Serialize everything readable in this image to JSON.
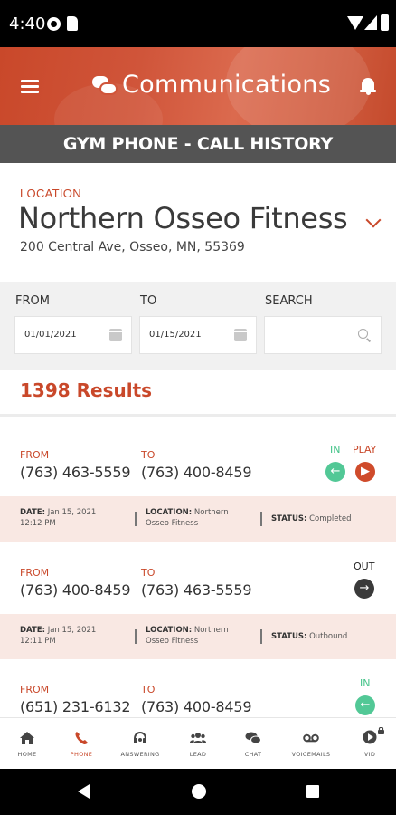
{
  "status_bar": {
    "time": "4:40"
  },
  "header": {
    "title": "Communications"
  },
  "subheader": {
    "title": "GYM PHONE - CALL HISTORY"
  },
  "location": {
    "label": "LOCATION",
    "name": "Northern Osseo Fitness",
    "address": "200 Central Ave, Osseo, MN, 55369"
  },
  "filters": {
    "from_label": "FROM",
    "to_label": "TO",
    "search_label": "SEARCH",
    "from_value": "01/01/2021",
    "to_value": "01/15/2021",
    "search_value": ""
  },
  "results": {
    "count_text": "1398 Results"
  },
  "calls": [
    {
      "from_label": "FROM",
      "to_label": "TO",
      "from": "(763) 463-5559",
      "to": "(763) 400-8459",
      "direction": "IN",
      "play_label": "PLAY",
      "date_label": "DATE:",
      "date": "Jan 15, 2021",
      "time": "12:12 PM",
      "location_label": "LOCATION:",
      "location_line1": "Northern",
      "location_line2": "Osseo Fitness",
      "status_label": "STATUS:",
      "status": "Completed"
    },
    {
      "from_label": "FROM",
      "to_label": "TO",
      "from": "(763) 400-8459",
      "to": "(763) 463-5559",
      "direction": "OUT",
      "date_label": "DATE:",
      "date": "Jan 15, 2021",
      "time": "12:11 PM",
      "location_label": "LOCATION:",
      "location_line1": "Northern",
      "location_line2": "Osseo Fitness",
      "status_label": "STATUS:",
      "status": "Outbound"
    },
    {
      "from_label": "FROM",
      "to_label": "TO",
      "from": "(651) 231-6132",
      "to": "(763) 400-8459",
      "direction": "IN"
    }
  ],
  "bottom_nav": [
    {
      "label": "HOME",
      "icon": "home-icon"
    },
    {
      "label": "PHONE",
      "icon": "phone-icon",
      "active": true
    },
    {
      "label": "ANSWERING",
      "icon": "headset-icon"
    },
    {
      "label": "LEAD",
      "icon": "people-icon"
    },
    {
      "label": "CHAT",
      "icon": "chat-icon"
    },
    {
      "label": "VOICEMAILS",
      "icon": "voicemail-icon"
    },
    {
      "label": "VID",
      "icon": "video-play-icon"
    }
  ],
  "colors": {
    "brand": "#c9482a",
    "subheader_bg": "#545454",
    "in_green": "#52c896",
    "detail_bg": "#f9e8e3"
  }
}
